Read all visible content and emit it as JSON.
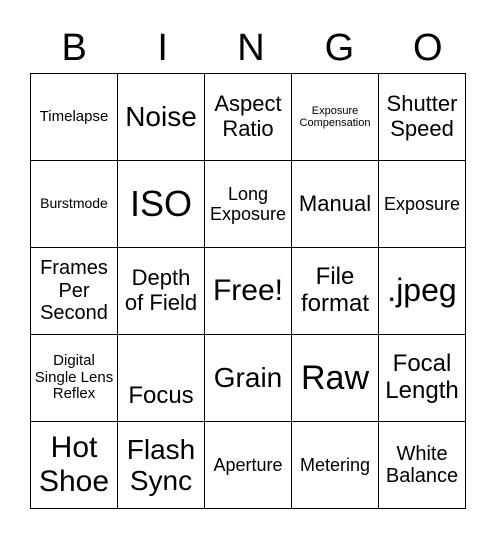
{
  "header": [
    "B",
    "I",
    "N",
    "G",
    "O"
  ],
  "rows": [
    [
      "Timelapse",
      "Noise",
      "Aspect Ratio",
      "Exposure Compensation",
      "Shutter Speed"
    ],
    [
      "Burstmode",
      "ISO",
      "Long Exposure",
      "Manual",
      "Exposure"
    ],
    [
      "Frames Per Second",
      "Depth of Field",
      "Free!",
      "File format",
      ".jpeg"
    ],
    [
      "Digital Single Lens Reflex",
      "Focus",
      "Grain",
      "Raw",
      "Focal Length"
    ],
    [
      "Hot Shoe",
      "Flash Sync",
      "Aperture",
      "Metering",
      "White Balance"
    ]
  ]
}
